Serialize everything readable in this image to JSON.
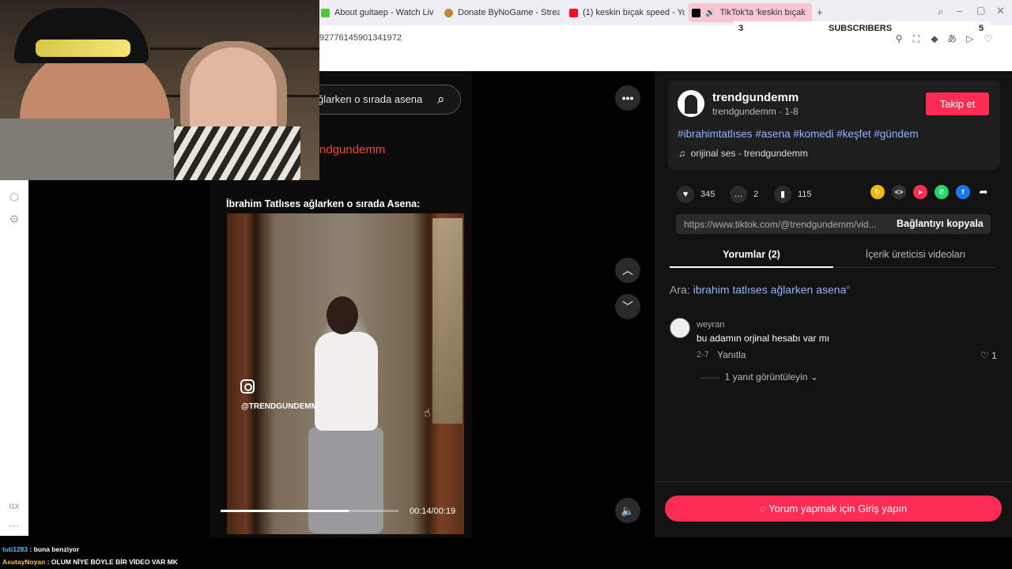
{
  "browser": {
    "tabs": [
      {
        "label": "About guitaep - Watch Liv",
        "color": "#53c53b"
      },
      {
        "label": "Donate ByNoGame - Strea",
        "color": "#b88c3a"
      },
      {
        "label": "(1) keskin bıçak speed - Yo",
        "color": "#ff0033"
      },
      {
        "label": "TikTok'ta 'keskin bıçak",
        "color": "#000000"
      }
    ],
    "url_fragment": "927761459013419​72",
    "subscribers_label": "SUBSCRIBERS",
    "subscribers_left": "3",
    "subscribers_right": "5"
  },
  "video": {
    "search_text": "ğlarken o sırada asena",
    "user_overlay": "ndgundemm",
    "caption": "İbrahim Tatlıses ağlarken o sırada Asena:",
    "ig_handle": "@TRENDGUNDEMM",
    "time": "00:14/00:19",
    "progress": 0.72
  },
  "author": {
    "name": "trendgundemm",
    "subtitle": "trendgundemm · 1-8",
    "follow_label": "Takip et",
    "hashtags": "#ibrahimtatlıses #asena #komedi #keşfet #gündem",
    "music": "orijinal ses - trendgundemm"
  },
  "stats": {
    "likes": "345",
    "comments": "2",
    "saves": "115"
  },
  "share": {
    "link": "https://www.tiktok.com/@trendgundemm/vid...",
    "copy_label": "Bağlantıyı kopyala"
  },
  "tabs": {
    "comments": "Yorumlar (2)",
    "creator": "İçerik üreticisi videoları"
  },
  "related_search": {
    "prefix": "Ara: ",
    "query": "ibrahim tatlıses ağlarken asena"
  },
  "comment": {
    "user": "weyran",
    "text": "bu adamın orjinal hesabı var mı",
    "date": "2-7",
    "reply_label": "Yanıtla",
    "likes": "1",
    "view_replies": "1 yanıt görüntüleyin"
  },
  "login_button": "Yorum yapmak için Giriş yapın",
  "chat": [
    {
      "user": "tuti1283",
      "message": "buna benziyor"
    },
    {
      "user": "AsutayNoyan",
      "message": "OLUM NİYE BÖYLE BİR VİDEO VAR MK"
    }
  ],
  "sidebar_gx": "GX",
  "colors": {
    "accent": "#fe2c55",
    "hashtag": "#8fb4ff"
  }
}
